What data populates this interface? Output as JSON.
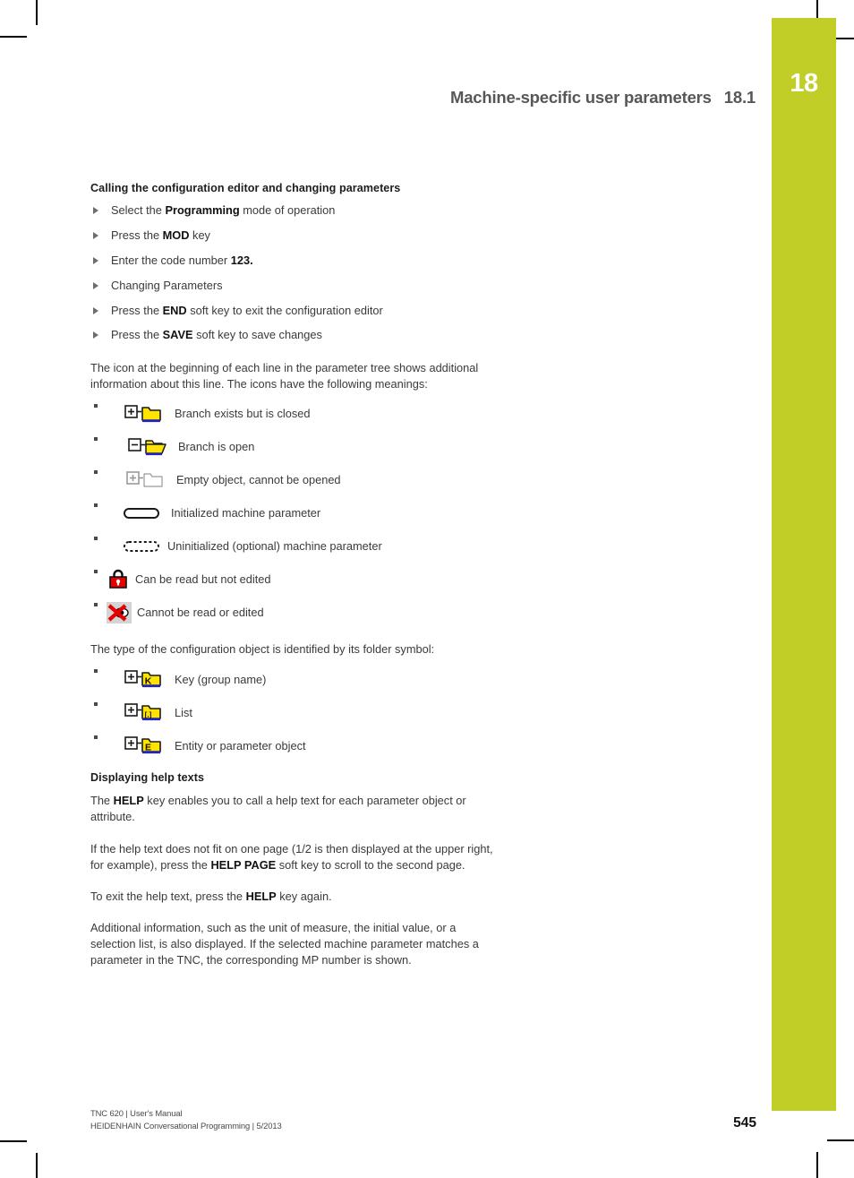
{
  "chapter_tab": {
    "number": "18",
    "color": "#c2ce28"
  },
  "header": {
    "title": "Machine-specific user parameters",
    "section": "18.1"
  },
  "content": {
    "heading_1": "Calling the configuration editor and changing parameters",
    "steps": [
      {
        "prefix": "Select the ",
        "bold": "Programming",
        "suffix": " mode of operation"
      },
      {
        "prefix": "Press the ",
        "bold": "MOD",
        "suffix": " key"
      },
      {
        "prefix": "Enter the code number ",
        "bold": "123.",
        "suffix": ""
      },
      {
        "prefix": "Changing Parameters",
        "bold": "",
        "suffix": ""
      },
      {
        "prefix": "Press the ",
        "bold": "END",
        "suffix": " soft key to exit the configuration editor"
      },
      {
        "prefix": "Press the ",
        "bold": "SAVE",
        "suffix": " soft key to save changes"
      }
    ],
    "intro_paragraph": "The icon at the beginning of each line in the parameter tree shows additional information about this line. The icons have the following meanings:",
    "icon_legend": [
      {
        "icon": "folder-closed-plus-icon",
        "label": "Branch exists but is closed"
      },
      {
        "icon": "folder-open-minus-icon",
        "label": "Branch is open"
      },
      {
        "icon": "folder-empty-plus-icon",
        "label": "Empty object, cannot be opened"
      },
      {
        "icon": "solid-capsule-icon",
        "label": "Initialized machine parameter"
      },
      {
        "icon": "dashed-capsule-icon",
        "label": "Uninitialized (optional) machine parameter"
      },
      {
        "icon": "padlock-icon",
        "label": "Can be read but not edited"
      },
      {
        "icon": "crossed-out-icon",
        "label": "Cannot be read or edited"
      }
    ],
    "folder_paragraph": "The type of the configuration object is identified by its folder symbol:",
    "folder_legend": [
      {
        "icon": "folder-key-icon",
        "letter": "K",
        "label": "Key (group name)"
      },
      {
        "icon": "folder-list-icon",
        "letter": "[.]",
        "label": "List"
      },
      {
        "icon": "folder-entity-icon",
        "letter": "E",
        "label": "Entity or parameter object"
      }
    ],
    "heading_2": "Displaying help texts",
    "help_paragraphs": [
      {
        "segments": [
          {
            "t": "The ",
            "b": false
          },
          {
            "t": "HELP",
            "b": true
          },
          {
            "t": " key enables you to call a help text for each parameter object or attribute.",
            "b": false
          }
        ]
      },
      {
        "segments": [
          {
            "t": "If the help text does not fit on one page (1/2 is then displayed at the upper right, for example), press the ",
            "b": false
          },
          {
            "t": "HELP PAGE",
            "b": true
          },
          {
            "t": " soft key to scroll to the second page.",
            "b": false
          }
        ]
      },
      {
        "segments": [
          {
            "t": "To exit the help text, press the ",
            "b": false
          },
          {
            "t": "HELP",
            "b": true
          },
          {
            "t": " key again.",
            "b": false
          }
        ]
      },
      {
        "segments": [
          {
            "t": "Additional information, such as the unit of measure, the initial value, or a selection list, is also displayed. If the selected machine parameter matches a parameter in the TNC, the corresponding MP number is shown.",
            "b": false
          }
        ]
      }
    ]
  },
  "footer": {
    "line1": "TNC 620 | User's Manual",
    "line2": "HEIDENHAIN Conversational Programming | 5/2013",
    "page_number": "545"
  }
}
